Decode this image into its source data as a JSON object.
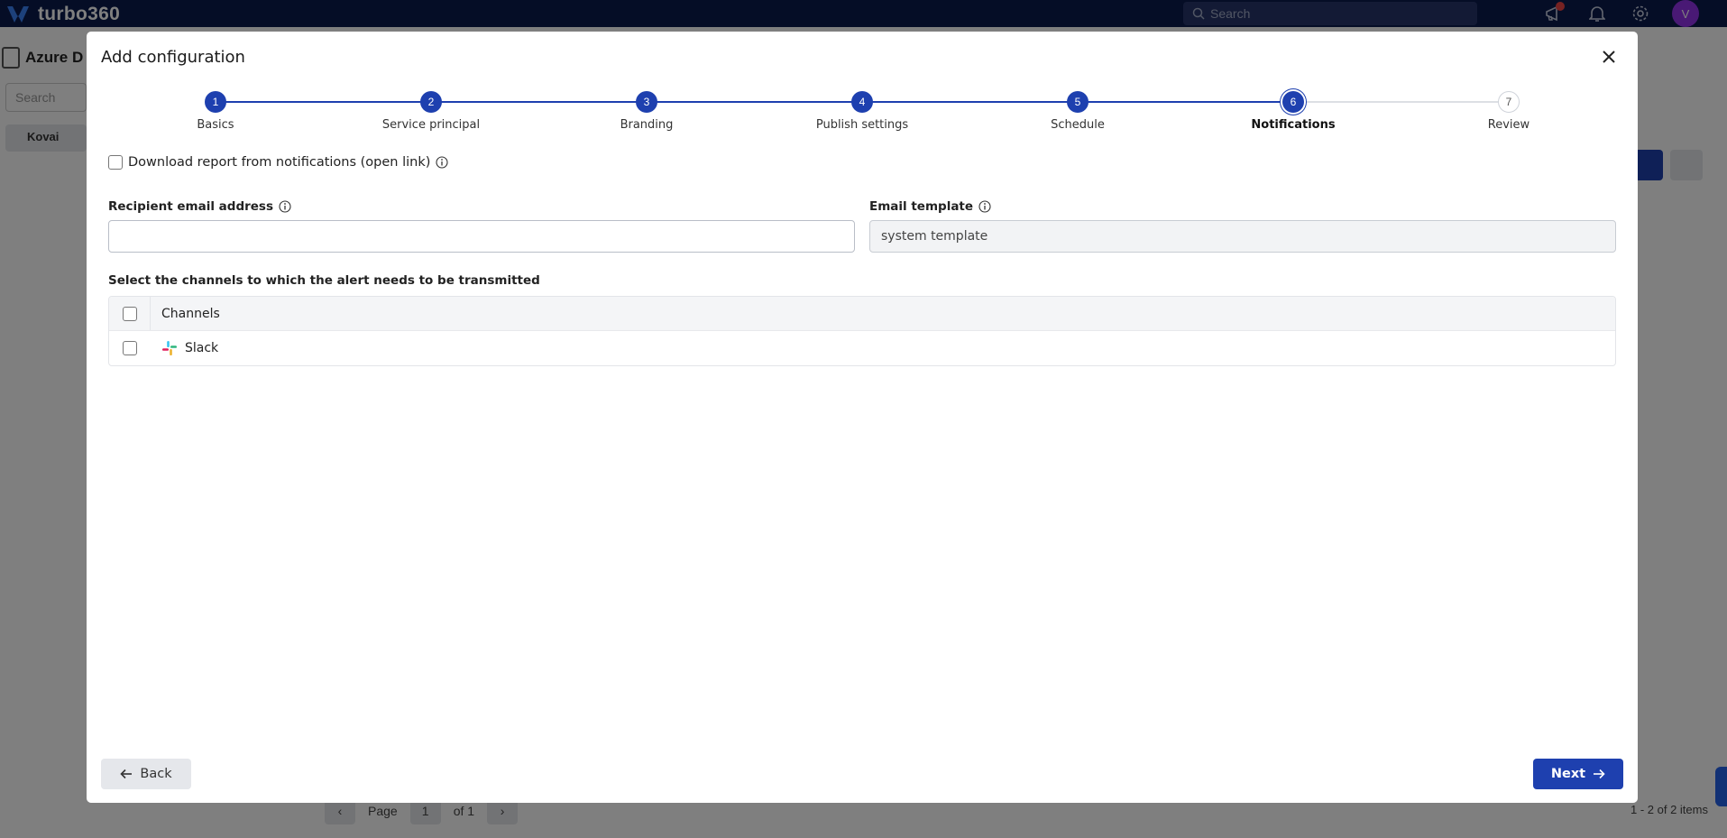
{
  "app": {
    "brand": "turbo360",
    "search_placeholder": "Search",
    "avatar_initial": "V",
    "left_title": "Azure D",
    "left_search_placeholder": "Search",
    "left_folder": "Kovai",
    "pager": {
      "page_label": "Page",
      "page_value": "1",
      "of_label": "of 1"
    },
    "items_count": "1 - 2 of 2 items"
  },
  "modal": {
    "title": "Add configuration",
    "steps": [
      {
        "number": "1",
        "label": "Basics",
        "state": "done"
      },
      {
        "number": "2",
        "label": "Service principal",
        "state": "done"
      },
      {
        "number": "3",
        "label": "Branding",
        "state": "done"
      },
      {
        "number": "4",
        "label": "Publish settings",
        "state": "done"
      },
      {
        "number": "5",
        "label": "Schedule",
        "state": "done"
      },
      {
        "number": "6",
        "label": "Notifications",
        "state": "active"
      },
      {
        "number": "7",
        "label": "Review",
        "state": "todo"
      }
    ],
    "download_report_label": "Download report from notifications (open link)",
    "recipient_label": "Recipient email address",
    "recipient_value": "",
    "email_template_label": "Email template",
    "email_template_value": "system template",
    "channels_prompt": "Select the channels to which the alert needs to be transmitted",
    "channels_header": "Channels",
    "channels": [
      {
        "name": "Slack",
        "icon": "slack-icon"
      }
    ],
    "back_label": "Back",
    "next_label": "Next"
  },
  "colors": {
    "primary": "#1e40af",
    "topbar": "#0b1b4d"
  }
}
